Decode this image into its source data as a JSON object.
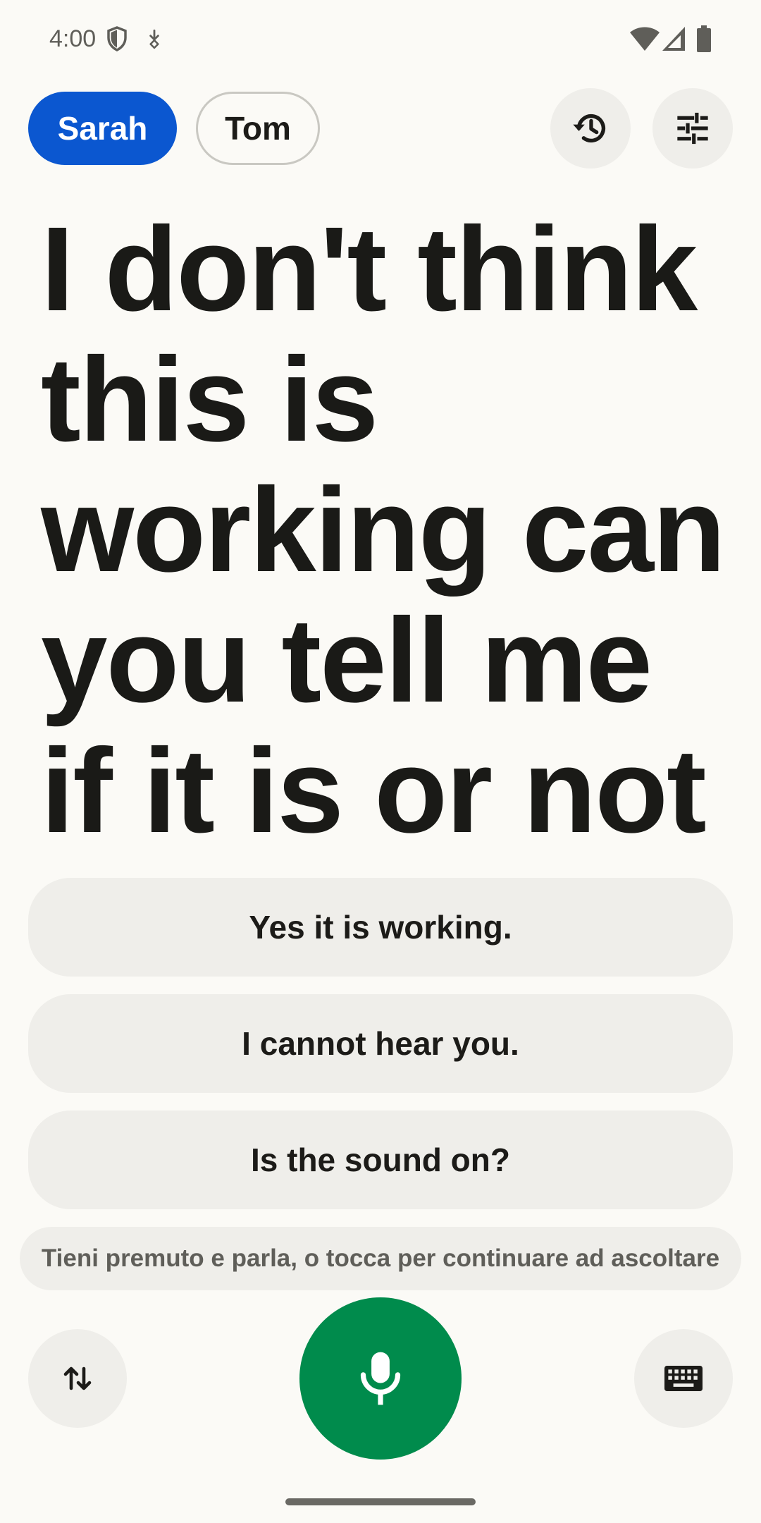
{
  "status_bar": {
    "time": "4:00",
    "icons": [
      "shield-icon",
      "download-icon",
      "wifi-icon",
      "signal-icon",
      "battery-icon"
    ]
  },
  "speakers": [
    {
      "name": "Sarah",
      "active": true
    },
    {
      "name": "Tom",
      "active": false
    }
  ],
  "toolbar": {
    "history_icon": "history-icon",
    "settings_icon": "tune-icon"
  },
  "transcript": {
    "text": "I don't think this is working can you tell me if it is or not"
  },
  "suggestions": [
    "Yes it is working.",
    "I cannot hear you.",
    "Is the sound on?"
  ],
  "hint": "Tieni premuto e parla, o tocca per continuare ad ascoltare",
  "bottom_bar": {
    "swap_icon": "swap-vertical-icon",
    "mic_icon": "microphone-icon",
    "keyboard_icon": "keyboard-icon"
  },
  "colors": {
    "background": "#fbfaf6",
    "active_chip": "#0b57d0",
    "mic_button": "#008b4c",
    "surface": "#efeeea"
  }
}
